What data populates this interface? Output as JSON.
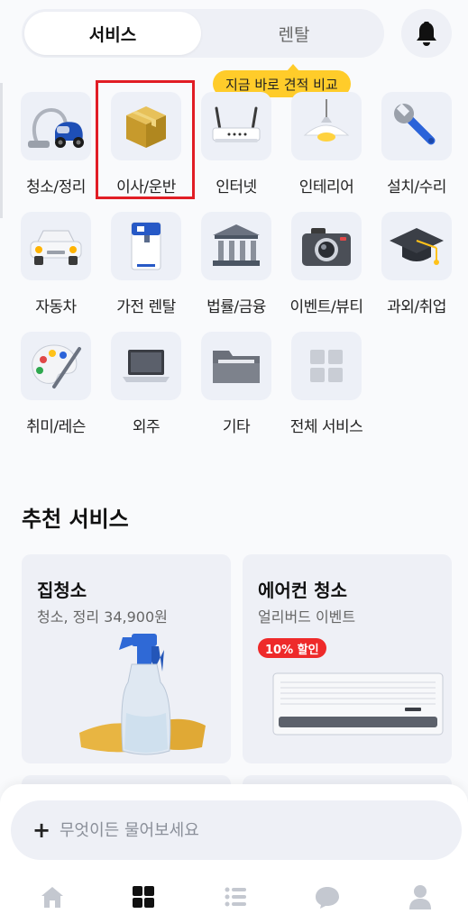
{
  "tabs": [
    {
      "label": "서비스",
      "active": true
    },
    {
      "label": "렌탈",
      "active": false
    }
  ],
  "tooltip": "지금 바로 견적 비교",
  "services": [
    {
      "label": "청소/정리",
      "icon": "vacuum-icon"
    },
    {
      "label": "이사/운반",
      "icon": "box-icon"
    },
    {
      "label": "인터넷",
      "icon": "router-icon"
    },
    {
      "label": "인테리어",
      "icon": "lamp-icon"
    },
    {
      "label": "설치/수리",
      "icon": "wrench-icon"
    },
    {
      "label": "자동차",
      "icon": "car-icon"
    },
    {
      "label": "가전 렌탈",
      "icon": "water-purifier-icon"
    },
    {
      "label": "법률/금융",
      "icon": "bank-icon"
    },
    {
      "label": "이벤트/뷰티",
      "icon": "camera-icon"
    },
    {
      "label": "과외/취업",
      "icon": "graduation-cap-icon"
    },
    {
      "label": "취미/레슨",
      "icon": "palette-icon"
    },
    {
      "label": "외주",
      "icon": "laptop-icon"
    },
    {
      "label": "기타",
      "icon": "folder-icon"
    },
    {
      "label": "전체 서비스",
      "icon": "grid-icon"
    }
  ],
  "recommended": {
    "title": "추천 서비스",
    "cards": [
      {
        "title": "집청소",
        "subtitle": "청소, 정리 34,900원",
        "badge": "",
        "image": "spray-bottle-and-gloves"
      },
      {
        "title": "에어컨 청소",
        "subtitle": "얼리버드 이벤트",
        "badge": "10% 할인",
        "image": "air-conditioner"
      }
    ]
  },
  "ask": {
    "placeholder": "무엇이든 물어보세요"
  },
  "bottom_nav": [
    "home-icon",
    "grid-icon",
    "list-icon",
    "chat-icon",
    "profile-icon"
  ],
  "colors": {
    "accent": "#ffcc2a",
    "badge": "#ee2a2a",
    "highlight": "#e11d25",
    "tile": "#edf0f7"
  }
}
